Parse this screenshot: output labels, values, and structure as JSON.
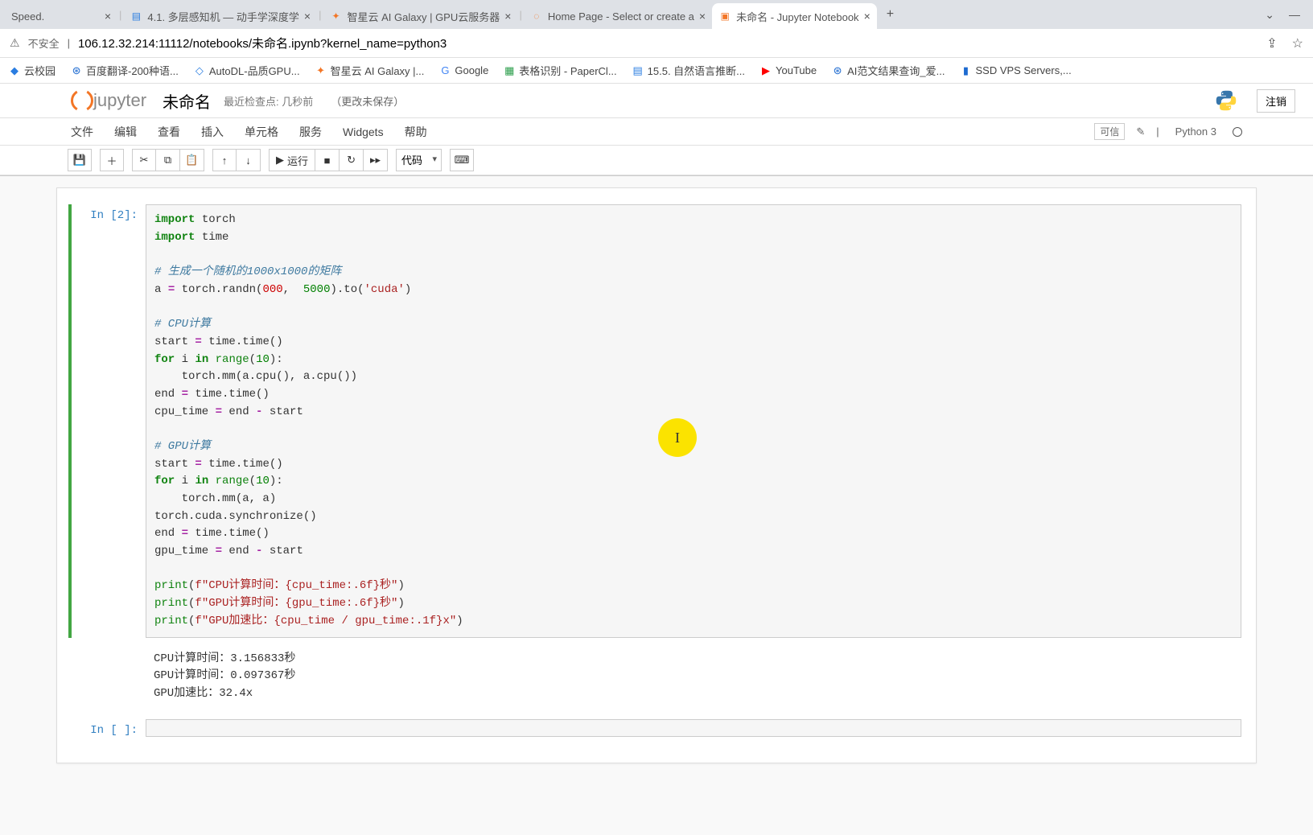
{
  "browser": {
    "tabs": [
      {
        "title": "Speed.",
        "icon": ""
      },
      {
        "title": "4.1. 多层感知机 — 动手学深度学",
        "icon": "📘"
      },
      {
        "title": "智星云 AI Galaxy | GPU云服务器",
        "icon": "✦"
      },
      {
        "title": "Home Page - Select or create a",
        "icon": "◌"
      },
      {
        "title": "未命名 - Jupyter Notebook",
        "icon": "📓",
        "active": true
      }
    ],
    "new_tab": "+",
    "dropdown": "⌄",
    "minimize": "—",
    "security_label": "不安全",
    "url": "106.12.32.214:11112/notebooks/未命名.ipynb?kernel_name=python3",
    "share": "⇪",
    "star": "☆"
  },
  "bookmarks": [
    {
      "label": "云校园",
      "color": "#2a7de1"
    },
    {
      "label": "百度翻译-200种语...",
      "color": "#1d6ad0"
    },
    {
      "label": "AutoDL-品质GPU...",
      "color": "#2a7de1"
    },
    {
      "label": "智星云 AI Galaxy |...",
      "color": "#f37626"
    },
    {
      "label": "Google",
      "color": "#4285f4"
    },
    {
      "label": "表格识别 - PaperCl...",
      "color": "#2a9d4a"
    },
    {
      "label": "15.5. 自然语言推断...",
      "color": "#2a7de1"
    },
    {
      "label": "YouTube",
      "color": "#ff0000"
    },
    {
      "label": "AI范文结果查询_爱...",
      "color": "#1d6ad0"
    },
    {
      "label": "SSD VPS Servers,...",
      "color": "#1d6ad0"
    }
  ],
  "jupyter": {
    "brand": "jupyter",
    "title": "未命名",
    "checkpoint": "最近检查点: 几秒前",
    "unsaved": "（更改未保存）",
    "logout": "注销",
    "kernel_name": "Python 3",
    "trusted": "可信"
  },
  "menu": [
    "文件",
    "编辑",
    "查看",
    "插入",
    "单元格",
    "服务",
    "Widgets",
    "帮助"
  ],
  "toolbar": {
    "run": "运行",
    "celltype": "代码"
  },
  "cells": {
    "prompt1": "In  [2]:",
    "code": {
      "l1a": "import",
      "l1b": " torch",
      "l2a": "import",
      "l2b": " time",
      "c1": "# 生成一个随机的1000x1000的矩阵",
      "l3a": "a ",
      "l3b": "=",
      "l3c": " torch.randn(",
      "l3d": "000",
      "l3e": ",  ",
      "l3f": "5000",
      "l3g": ").to(",
      "l3h": "'cuda'",
      "l3i": ")",
      "c2": "# CPU计算",
      "l4a": "start ",
      "l4b": "=",
      "l4c": " time.time()",
      "l5a": "for",
      "l5b": " i ",
      "l5c": "in",
      "l5d": " ",
      "l5e": "range",
      "l5f": "(",
      "l5g": "10",
      "l5h": "):",
      "l6": "    torch.mm(a.cpu(), a.cpu())",
      "l7a": "end ",
      "l7b": "=",
      "l7c": " time.time()",
      "l8a": "cpu_time ",
      "l8b": "=",
      "l8c": " end ",
      "l8d": "-",
      "l8e": " start",
      "c3": "# GPU计算",
      "l9a": "start ",
      "l9b": "=",
      "l9c": " time.time()",
      "l10a": "for",
      "l10b": " i ",
      "l10c": "in",
      "l10d": " ",
      "l10e": "range",
      "l10f": "(",
      "l10g": "10",
      "l10h": "):",
      "l11": "    torch.mm(a, a)",
      "l12": "torch.cuda.synchronize()",
      "l13a": "end ",
      "l13b": "=",
      "l13c": " time.time()",
      "l14a": "gpu_time ",
      "l14b": "=",
      "l14c": " end ",
      "l14d": "-",
      "l14e": " start",
      "p1a": "print",
      "p1b": "(",
      "p1c": "f\"CPU计算时间：{cpu_time:.6f}秒\"",
      "p1d": ")",
      "p2a": "print",
      "p2b": "(",
      "p2c": "f\"GPU计算时间：{gpu_time:.6f}秒\"",
      "p2d": ")",
      "p3a": "print",
      "p3b": "(",
      "p3c": "f\"GPU加速比：{cpu_time / gpu_time:.1f}x\"",
      "p3d": ")"
    },
    "output": "CPU计算时间：3.156833秒\nGPU计算时间：0.097367秒\nGPU加速比：32.4x",
    "prompt2": "In  [ ]:"
  },
  "cursor_char": "I"
}
